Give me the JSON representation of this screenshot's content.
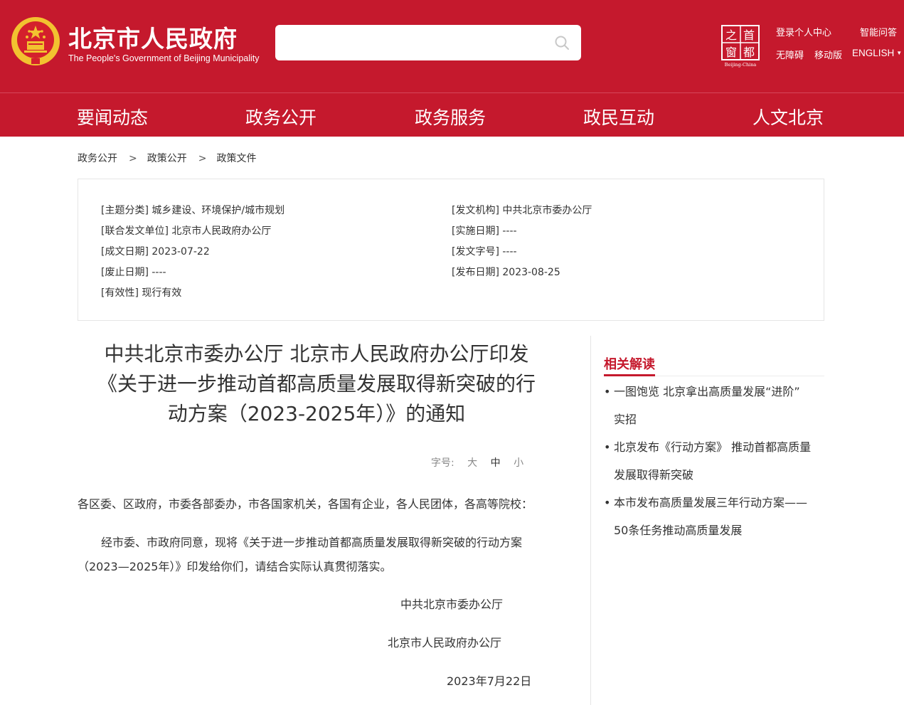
{
  "header": {
    "site_title": "北京市人民政府",
    "site_subtitle": "The People's Government of Beijing Municipality",
    "search_placeholder": "",
    "logo_chars": [
      "之",
      "首",
      "窗",
      "都"
    ],
    "logo_caption": "Beijing-China",
    "links": {
      "login": "登录个人中心",
      "smart_qa": "智能问答",
      "accessibility": "无障碍",
      "mobile": "移动版",
      "english": "ENGLISH"
    }
  },
  "nav": [
    "要闻动态",
    "政务公开",
    "政务服务",
    "政民互动",
    "人文北京"
  ],
  "breadcrumb": [
    "政务公开",
    "政策公开",
    "政策文件"
  ],
  "meta": {
    "left": [
      "[主题分类] 城乡建设、环境保护/城市规划",
      "[联合发文单位] 北京市人民政府办公厅",
      "[成文日期] 2023-07-22",
      "[废止日期] ----",
      "[有效性] 现行有效"
    ],
    "right": [
      "[发文机构] 中共北京市委办公厅",
      "[实施日期] ----",
      "[发文字号] ----",
      "[发布日期] 2023-08-25"
    ]
  },
  "article": {
    "title_lines": [
      "中共北京市委办公厅 北京市人民政府办公厅印发",
      "《关于进一步推动首都高质量发展取得新突破的行",
      "动方案（2023-2025年）》的通知"
    ],
    "fontsize_label": "字号:",
    "fontsize_options": [
      "大",
      "中",
      "小"
    ],
    "fontsize_selected": "中",
    "salutation": "各区委、区政府，市委各部委办，市各国家机关，各国有企业，各人民团体，各高等院校：",
    "body_line1": "经市委、市政府同意，现将《关于进一步推动首都高质量发展取得新突破的行动方案",
    "body_line2": "（2023—2025年）》印发给你们，请结合实际认真贯彻落实。",
    "signature1": "中共北京市委办公厅",
    "signature2": "北京市人民政府办公厅",
    "date": "2023年7月22日"
  },
  "sidebar": {
    "title": "相关解读",
    "bullet": "•",
    "links": [
      {
        "line1": "一图饱览 北京拿出高质量发展“进阶”",
        "line2": "实招"
      },
      {
        "line1": "北京发布《行动方案》 推动首都高质量",
        "line2": "发展取得新突破"
      },
      {
        "line1": "本市发布高质量发展三年行动方案——",
        "line2": "50条任务推动高质量发展"
      }
    ]
  },
  "colors": {
    "brand_red": "#c5192d",
    "emblem_gold": "#f2c230"
  }
}
